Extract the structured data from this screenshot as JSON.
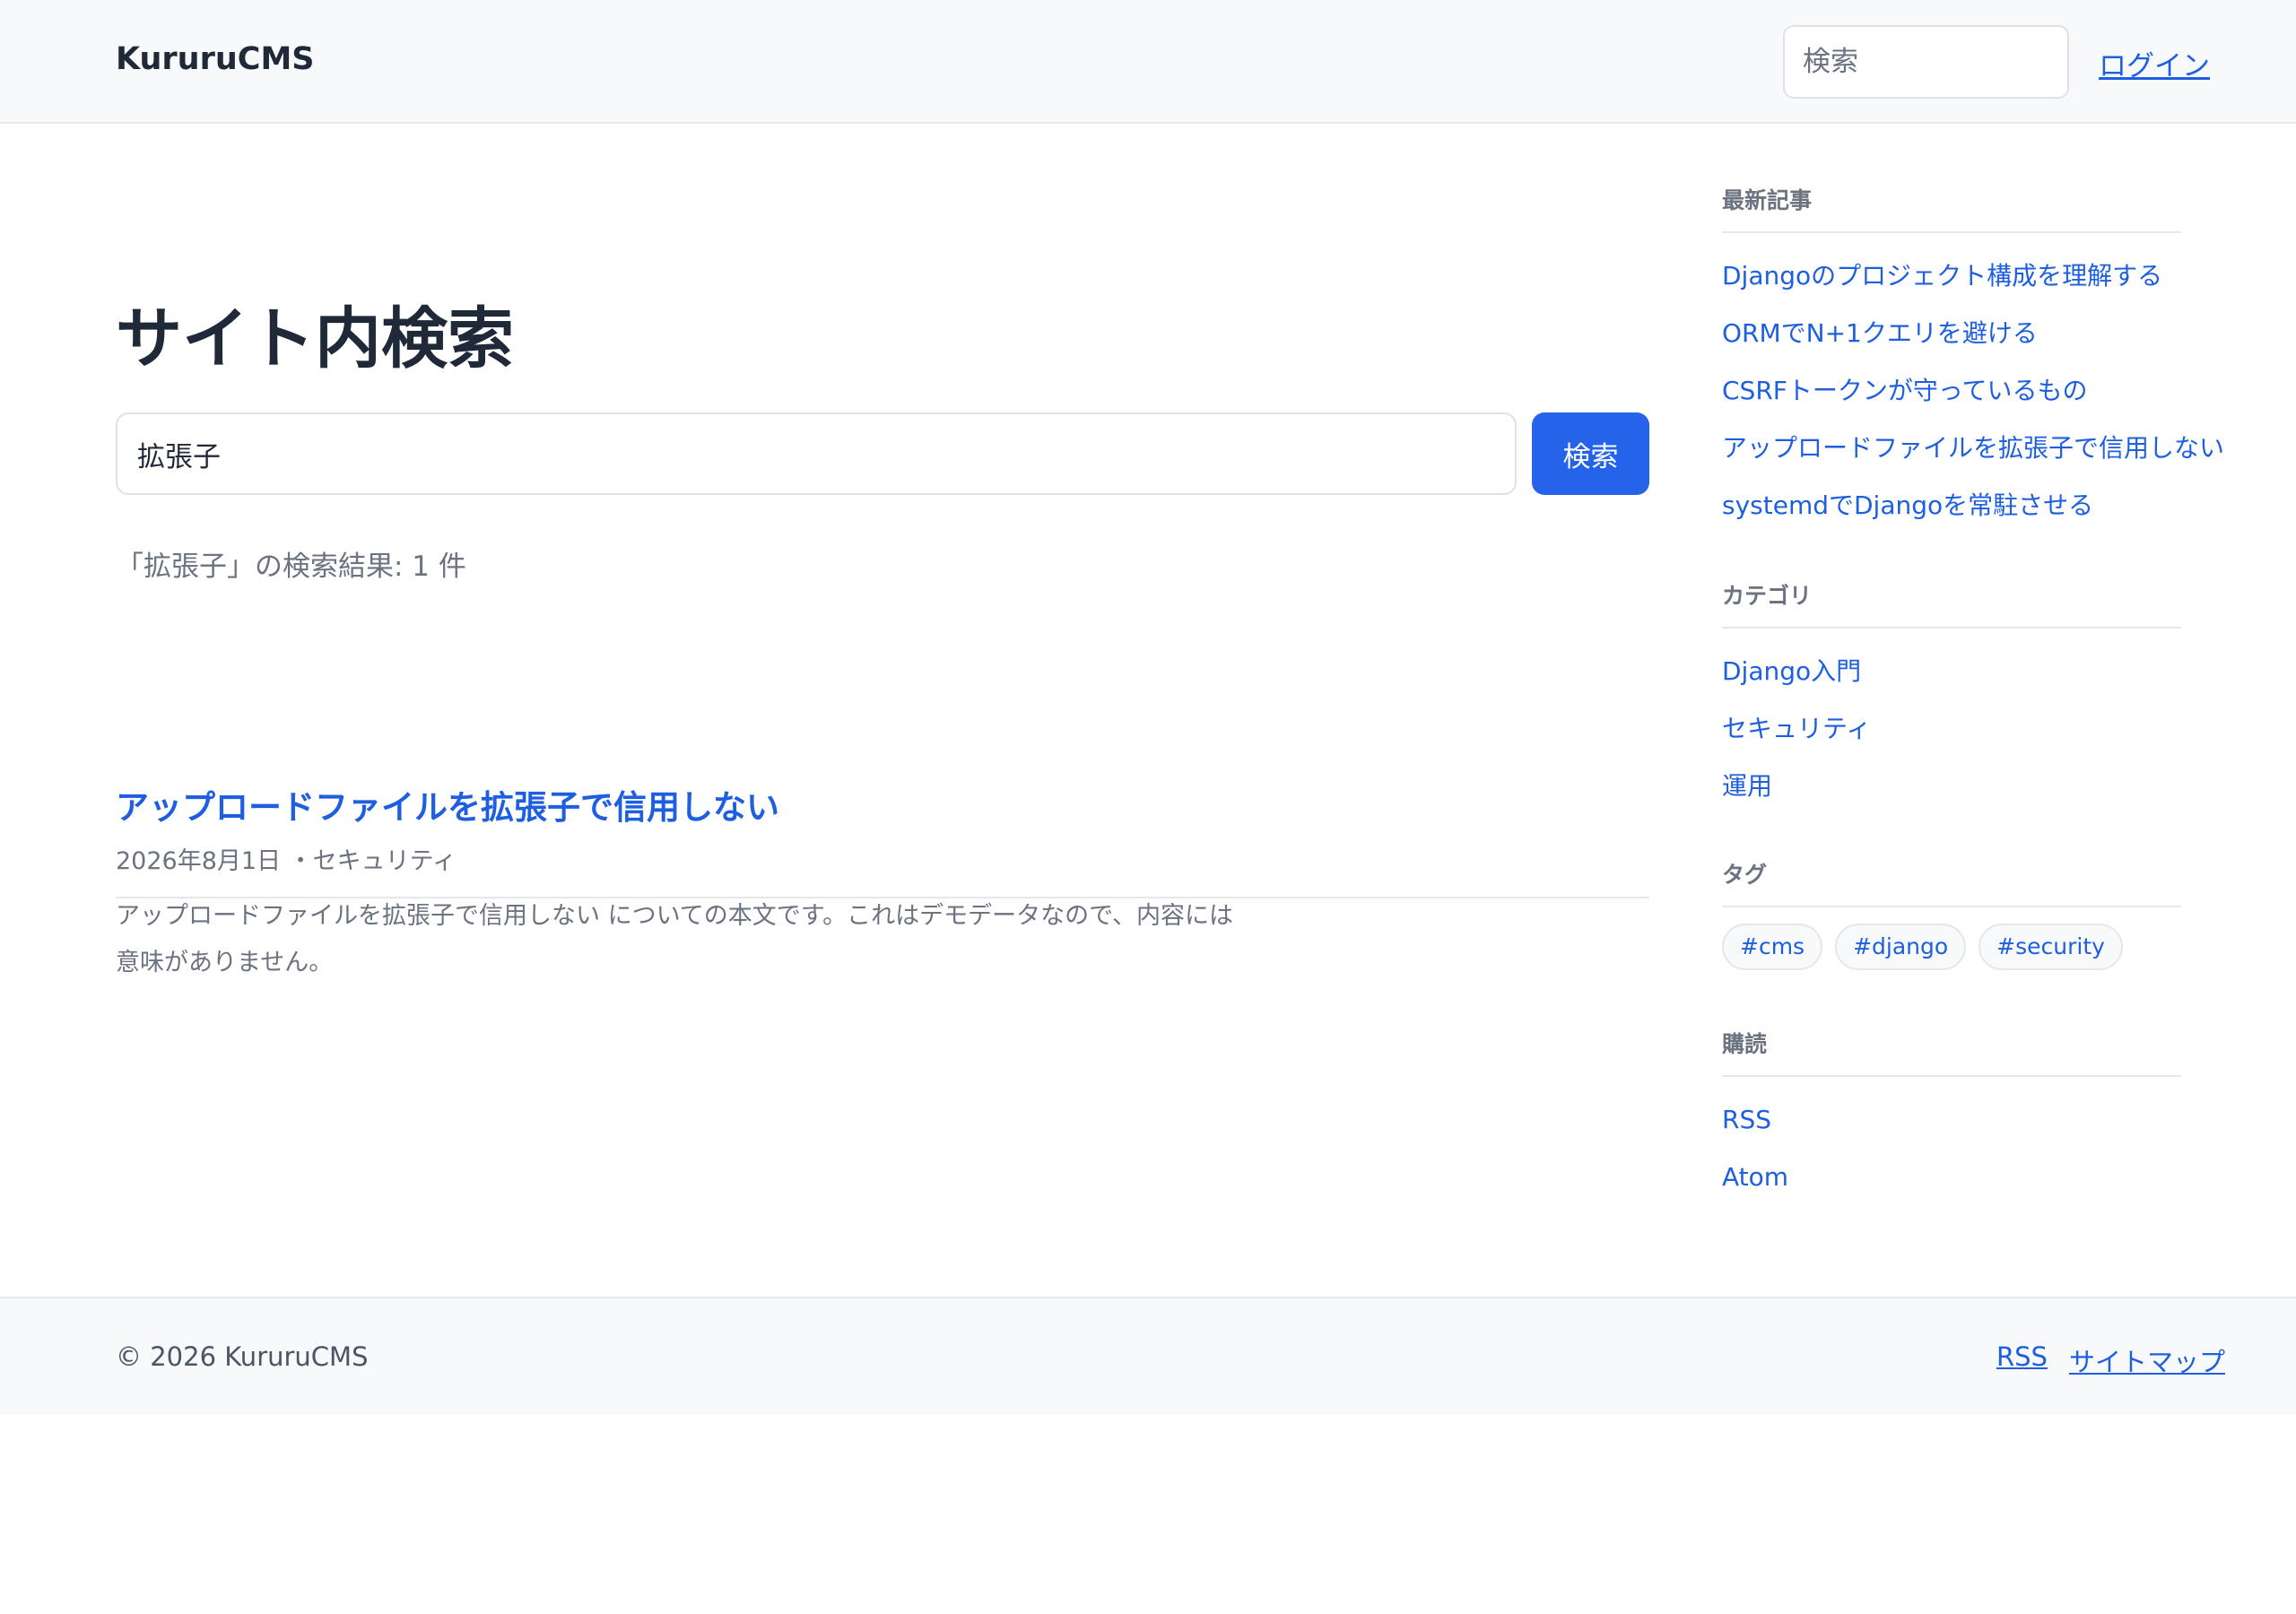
{
  "header": {
    "brand": "KururuCMS",
    "search_placeholder": "検索",
    "login_label": "ログイン"
  },
  "main": {
    "title": "サイト内検索",
    "search": {
      "value": "拡張子",
      "button_label": "検索"
    },
    "summary": "「拡張子」の検索結果: 1 件",
    "results": [
      {
        "title": "アップロードファイルを拡張子で信用しない",
        "meta": "2026年8月1日 ・セキュリティ",
        "excerpt": "アップロードファイルを拡張子で信用しない についての本文です。これはデモデータなので、内容には意味がありません。"
      }
    ]
  },
  "sidebar": {
    "recent": {
      "heading": "最新記事",
      "items": [
        "Djangoのプロジェクト構成を理解する",
        "ORMでN+1クエリを避ける",
        "CSRFトークンが守っているもの",
        "アップロードファイルを拡張子で信用しない",
        "systemdでDjangoを常駐させる"
      ]
    },
    "categories": {
      "heading": "カテゴリ",
      "items": [
        "Django入門",
        "セキュリティ",
        "運用"
      ]
    },
    "tags": {
      "heading": "タグ",
      "items": [
        "#cms",
        "#django",
        "#security"
      ]
    },
    "subscribe": {
      "heading": "購読",
      "items": [
        "RSS",
        "Atom"
      ]
    }
  },
  "footer": {
    "copyright": "© 2026 KururuCMS",
    "links": [
      "RSS",
      "サイトマップ"
    ]
  },
  "colors": {
    "accent": "#2563eb",
    "link": "#1d5fe0",
    "muted_text": "#6b7280",
    "header_bg": "#f8f9fa"
  }
}
